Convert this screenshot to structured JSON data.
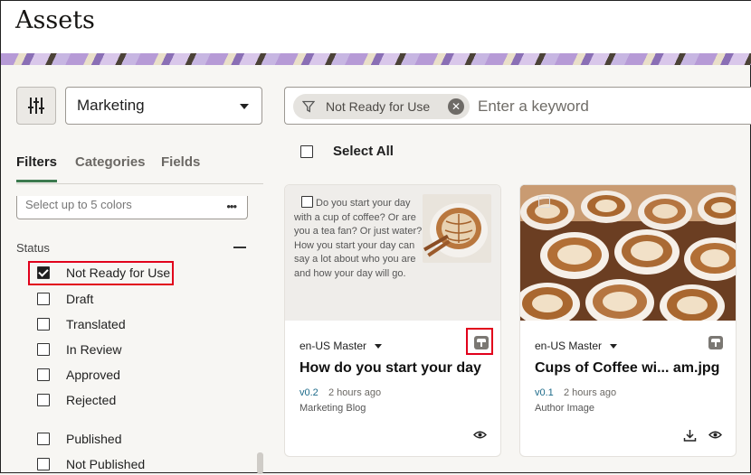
{
  "page": {
    "title": "Assets"
  },
  "repository": {
    "selected": "Marketing"
  },
  "search": {
    "filter_chip": "Not Ready for Use",
    "placeholder": "Enter a keyword"
  },
  "tabs": [
    "Filters",
    "Categories",
    "Fields"
  ],
  "colors": {
    "placeholder": "Select up to 5 colors",
    "accent": "#3c7a4f",
    "highlight": "#e1001b"
  },
  "status": {
    "label": "Status",
    "items": [
      {
        "label": "Not Ready for Use",
        "checked": true
      },
      {
        "label": "Draft",
        "checked": false
      },
      {
        "label": "Translated",
        "checked": false
      },
      {
        "label": "In Review",
        "checked": false
      },
      {
        "label": "Approved",
        "checked": false
      },
      {
        "label": "Rejected",
        "checked": false
      },
      {
        "label": "Published",
        "checked": false
      },
      {
        "label": "Not Published",
        "checked": false
      }
    ]
  },
  "select_all": "Select All",
  "cards": [
    {
      "preview_text": "Do you start your day with a cup of coffee? Or are you a tea fan? Or just water? How you start your day can say a lot about who you are and how your day will go.",
      "language": "en-US Master",
      "title": "How do you start your day",
      "version": "v0.2",
      "time": "2 hours ago",
      "collection": "Marketing Blog"
    },
    {
      "language": "en-US Master",
      "title": "Cups of Coffee wi... am.jpg",
      "version": "v0.1",
      "time": "2 hours ago",
      "collection": "Author Image"
    }
  ]
}
